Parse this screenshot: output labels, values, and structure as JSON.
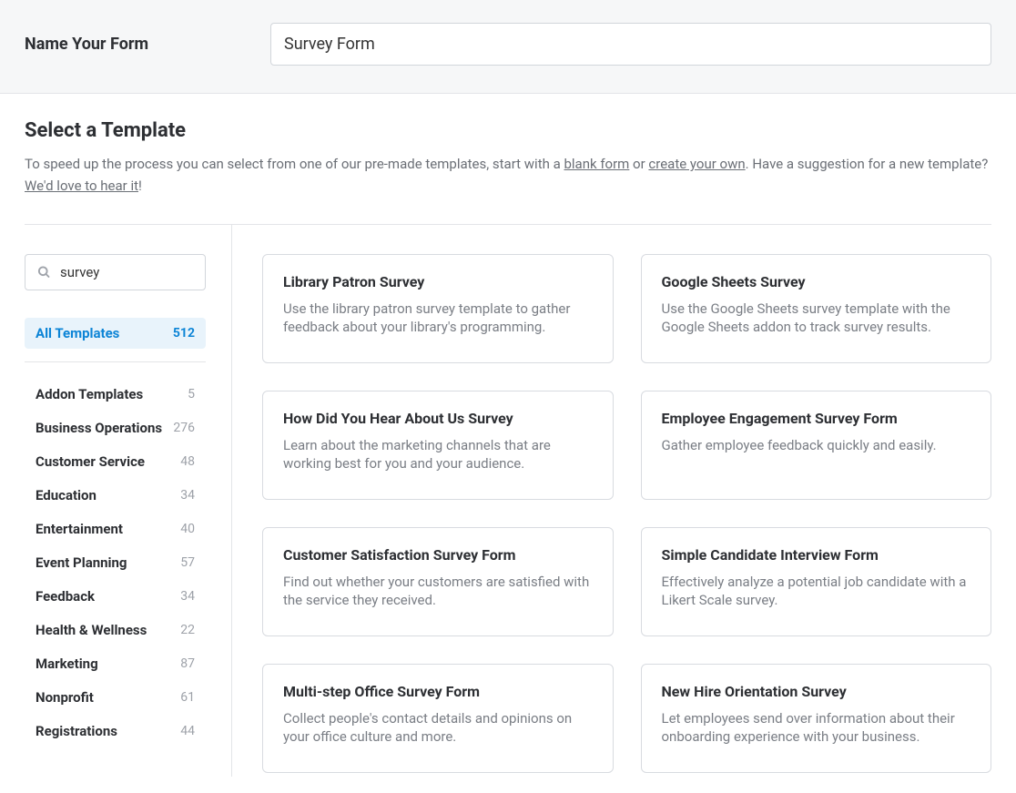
{
  "header": {
    "label": "Name Your Form",
    "value": "Survey Form"
  },
  "section": {
    "title": "Select a Template",
    "desc_prefix": "To speed up the process you can select from one of our pre-made templates, start with a ",
    "link_blank": "blank form",
    "desc_or": " or ",
    "link_create": "create your own",
    "desc_mid": ". Have a suggestion for a new template? ",
    "link_hear": "We'd love to hear it",
    "desc_suffix": "!"
  },
  "search": {
    "value": "survey",
    "placeholder": "Search Templates"
  },
  "categories": {
    "all": {
      "label": "All Templates",
      "count": "512"
    },
    "items": [
      {
        "label": "Addon Templates",
        "count": "5"
      },
      {
        "label": "Business Operations",
        "count": "276"
      },
      {
        "label": "Customer Service",
        "count": "48"
      },
      {
        "label": "Education",
        "count": "34"
      },
      {
        "label": "Entertainment",
        "count": "40"
      },
      {
        "label": "Event Planning",
        "count": "57"
      },
      {
        "label": "Feedback",
        "count": "34"
      },
      {
        "label": "Health & Wellness",
        "count": "22"
      },
      {
        "label": "Marketing",
        "count": "87"
      },
      {
        "label": "Nonprofit",
        "count": "61"
      },
      {
        "label": "Registrations",
        "count": "44"
      }
    ]
  },
  "templates": [
    {
      "title": "Library Patron Survey",
      "desc": "Use the library patron survey template to gather feedback about your library's programming."
    },
    {
      "title": "Google Sheets Survey",
      "desc": "Use the Google Sheets survey template with the Google Sheets addon to track survey results."
    },
    {
      "title": "How Did You Hear About Us Survey",
      "desc": "Learn about the marketing channels that are working best for you and your audience."
    },
    {
      "title": "Employee Engagement Survey Form",
      "desc": "Gather employee feedback quickly and easily."
    },
    {
      "title": "Customer Satisfaction Survey Form",
      "desc": "Find out whether your customers are satisfied with the service they received."
    },
    {
      "title": "Simple Candidate Interview Form",
      "desc": "Effectively analyze a potential job candidate with a Likert Scale survey."
    },
    {
      "title": "Multi-step Office Survey Form",
      "desc": "Collect people's contact details and opinions on your office culture and more."
    },
    {
      "title": "New Hire Orientation Survey",
      "desc": "Let employees send over information about their onboarding experience with your business."
    }
  ]
}
